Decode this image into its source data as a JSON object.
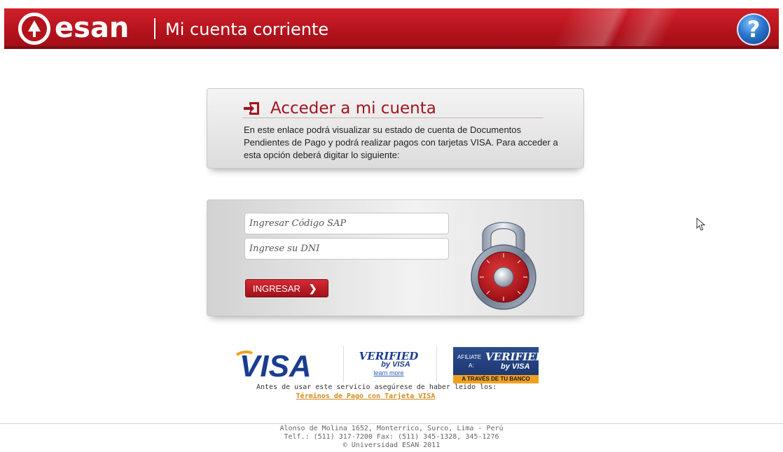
{
  "header": {
    "brand": "esan",
    "subtitle": "Mi cuenta corriente",
    "help_label": "?"
  },
  "intro": {
    "title": "Acceder a mi cuenta",
    "text": "En este enlace podrá visualizar su estado de cuenta de Documentos Pendientes de Pago y podrá realizar pagos con tarjetas VISA. Para acceder a esta opción deberá digitar lo siguiente:"
  },
  "login": {
    "sap_placeholder": "Ingresar Código SAP",
    "dni_placeholder": "Ingrese su DNI",
    "submit_label": "INGRESAR",
    "submit_arrow": "❯"
  },
  "payment": {
    "visa": "VISA",
    "verified_line1": "VERIFIED",
    "verified_line2": "by VISA",
    "verified_learn": "learn more",
    "afiliate_a1": "AFILIATE",
    "afiliate_a2": "A:",
    "afiliate_v1": "VERIFIED",
    "afiliate_v2": "by VISA",
    "afiliate_bar": "A TRAVÉS DE TU BANCO",
    "note": "Antes de usar este servicio asegúrese de haber leido los:",
    "terms_link": "Términos de Pago con Tarjeta VISA"
  },
  "footer": {
    "address": "Alonso de Molina 1652, Monterrico, Surco, Lima - Perú",
    "phones": "Telf.: (511) 317-7200 Fax: (511) 345-1328, 345-1276",
    "copyright": "© Universidad ESAN 2011"
  },
  "colors": {
    "header_red": "#b3121c",
    "title_red": "#a3141f",
    "link_orange": "#d48a1a",
    "visa_blue": "#1a3d8f",
    "visa_gold": "#f0a020"
  },
  "icons": [
    "university-seal-icon",
    "help-icon",
    "login-icon",
    "padlock-icon",
    "arrow-right-icon",
    "mouse-cursor-icon"
  ]
}
